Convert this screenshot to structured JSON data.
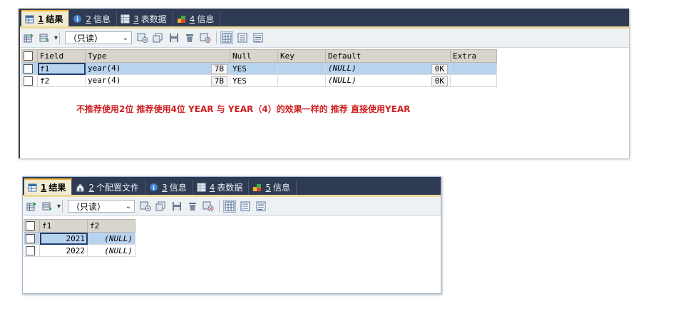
{
  "panel1": {
    "tabs": [
      {
        "num": "1",
        "label": "结果"
      },
      {
        "num": "2",
        "label": "信息"
      },
      {
        "num": "3",
        "label": "表数据"
      },
      {
        "num": "4",
        "label": "信息"
      }
    ],
    "mode": "（只读）",
    "columns": [
      "Field",
      "Type",
      "Null",
      "Key",
      "Default",
      "Extra"
    ],
    "rows": [
      {
        "field": "f1",
        "type": "year(4)",
        "type_size": "7B",
        "null": "YES",
        "key": "",
        "default": "(NULL)",
        "default_size": "0K",
        "extra": ""
      },
      {
        "field": "f2",
        "type": "year(4)",
        "type_size": "7B",
        "null": "YES",
        "key": "",
        "default": "(NULL)",
        "default_size": "0K",
        "extra": ""
      }
    ],
    "note": "不推荐使用2位 推荐使用4位 YEAR 与 YEAR（4）的效果一样的 推荐 直接使用YEAR"
  },
  "panel2": {
    "tabs": [
      {
        "num": "1",
        "label": "结果"
      },
      {
        "num": "2",
        "label": "个配置文件"
      },
      {
        "num": "3",
        "label": "信息"
      },
      {
        "num": "4",
        "label": "表数据"
      },
      {
        "num": "5",
        "label": "信息"
      }
    ],
    "mode": "（只读）",
    "columns": [
      "f1",
      "f2"
    ],
    "rows": [
      {
        "f1": "2021",
        "f2": "(NULL)"
      },
      {
        "f1": "2022",
        "f2": "(NULL)"
      }
    ]
  },
  "colors": {
    "tabbar": "#2f3b53",
    "active_tab": "#f1ebd2",
    "selected_row": "#b8d3ee",
    "note": "#cf1f23"
  }
}
